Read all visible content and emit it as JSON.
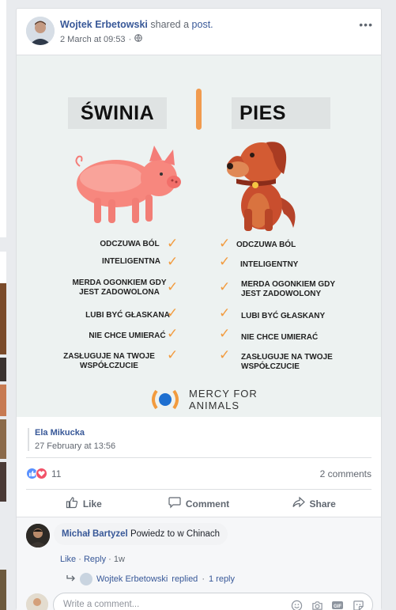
{
  "post": {
    "author": "Wojtek Erbetowski",
    "action": "shared a",
    "action_link": "post.",
    "timestamp": "2 March at 09:53",
    "visibility_icon": "globe-icon",
    "more_icon": "more-options-icon"
  },
  "infographic": {
    "left_title": "ŚWINIA",
    "right_title": "PIES",
    "accent_color": "#f29b3e",
    "left_traits": [
      "ODCZUWA BÓL",
      "INTELIGENTNA",
      "MERDA OGONKIEM GDY\nJEST ZADOWOLONA",
      "LUBI BYĆ GŁASKANA",
      "NIE CHCE UMIERAĆ",
      "ZASŁUGUJE NA TWOJE\nWSPÓŁCZUCIE"
    ],
    "right_traits": [
      "ODCZUWA BÓL",
      "INTELIGENTNY",
      "MERDA OGONKIEM GDY\nJEST ZADOWOLONY",
      "LUBI BYĆ GŁASKANY",
      "NIE CHCE UMIERAĆ",
      "ZASŁUGUJE NA TWOJE\nWSPÓŁCZUCIE"
    ],
    "brand_line1": "MERCY FOR",
    "brand_line2": "ANIMALS"
  },
  "shared_from": {
    "name": "Ela Mikucka",
    "date": "27 February at 13:56"
  },
  "reactions": {
    "count": "11",
    "comments": "2 comments",
    "like_color": "#5890ff",
    "love_color": "#f25268"
  },
  "actions": {
    "like": "Like",
    "comment": "Comment",
    "share": "Share"
  },
  "comment": {
    "author": "Michał Bartyzel",
    "text": "Powiedz to w Chinach",
    "like": "Like",
    "reply": "Reply",
    "time": "1w"
  },
  "reply_summary": {
    "author": "Wojtek Erbetowski",
    "replied": "replied",
    "count": "1 reply"
  },
  "compose": {
    "placeholder": "Write a comment..."
  }
}
